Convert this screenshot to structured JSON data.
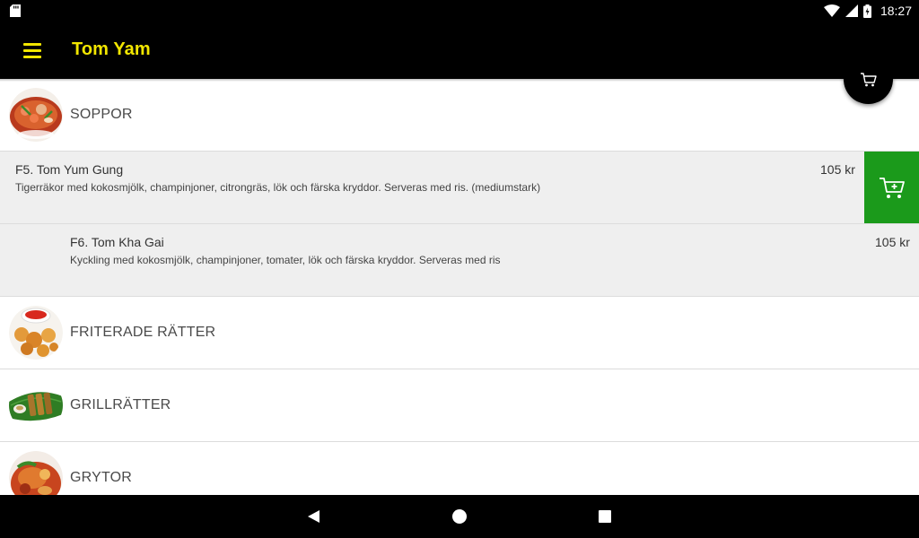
{
  "status_bar": {
    "time": "18:27",
    "icons": [
      "sd-card-icon",
      "wifi-icon",
      "signal-icon",
      "battery-charging-icon"
    ]
  },
  "app_bar": {
    "title": "Tom Yam",
    "menu_icon": "hamburger-menu-icon",
    "cart_icon": "cart-icon"
  },
  "categories": [
    {
      "name": "SOPPOR",
      "image": "soup-bowl-image"
    },
    {
      "name": "FRITERADE RÄTTER",
      "image": "fried-food-image"
    },
    {
      "name": "GRILLRÄTTER",
      "image": "grilled-skewers-image"
    },
    {
      "name": "GRYTOR",
      "image": "stew-dish-image"
    }
  ],
  "items": [
    {
      "name": "F5. Tom Yum Gung",
      "description": "Tigerräkor med kokosmjölk, champinjoner, citrongräs, lök och färska kryddor. Serveras med ris. (mediumstark)",
      "price": "105 kr",
      "action_icon": "add-to-cart-icon"
    },
    {
      "name": "F6. Tom Kha Gai",
      "description": "Kyckling med kokosmjölk, champinjoner, tomater, lök och färska kryddor. Serveras med ris",
      "price": "105 kr"
    }
  ],
  "colors": {
    "accent_yellow": "#f2e600",
    "add_button_green": "#1b9a1b",
    "item_background": "#efefef",
    "app_bar": "#000000"
  },
  "nav_bar": {
    "icons": [
      "back-icon",
      "home-icon",
      "recent-apps-icon"
    ]
  }
}
